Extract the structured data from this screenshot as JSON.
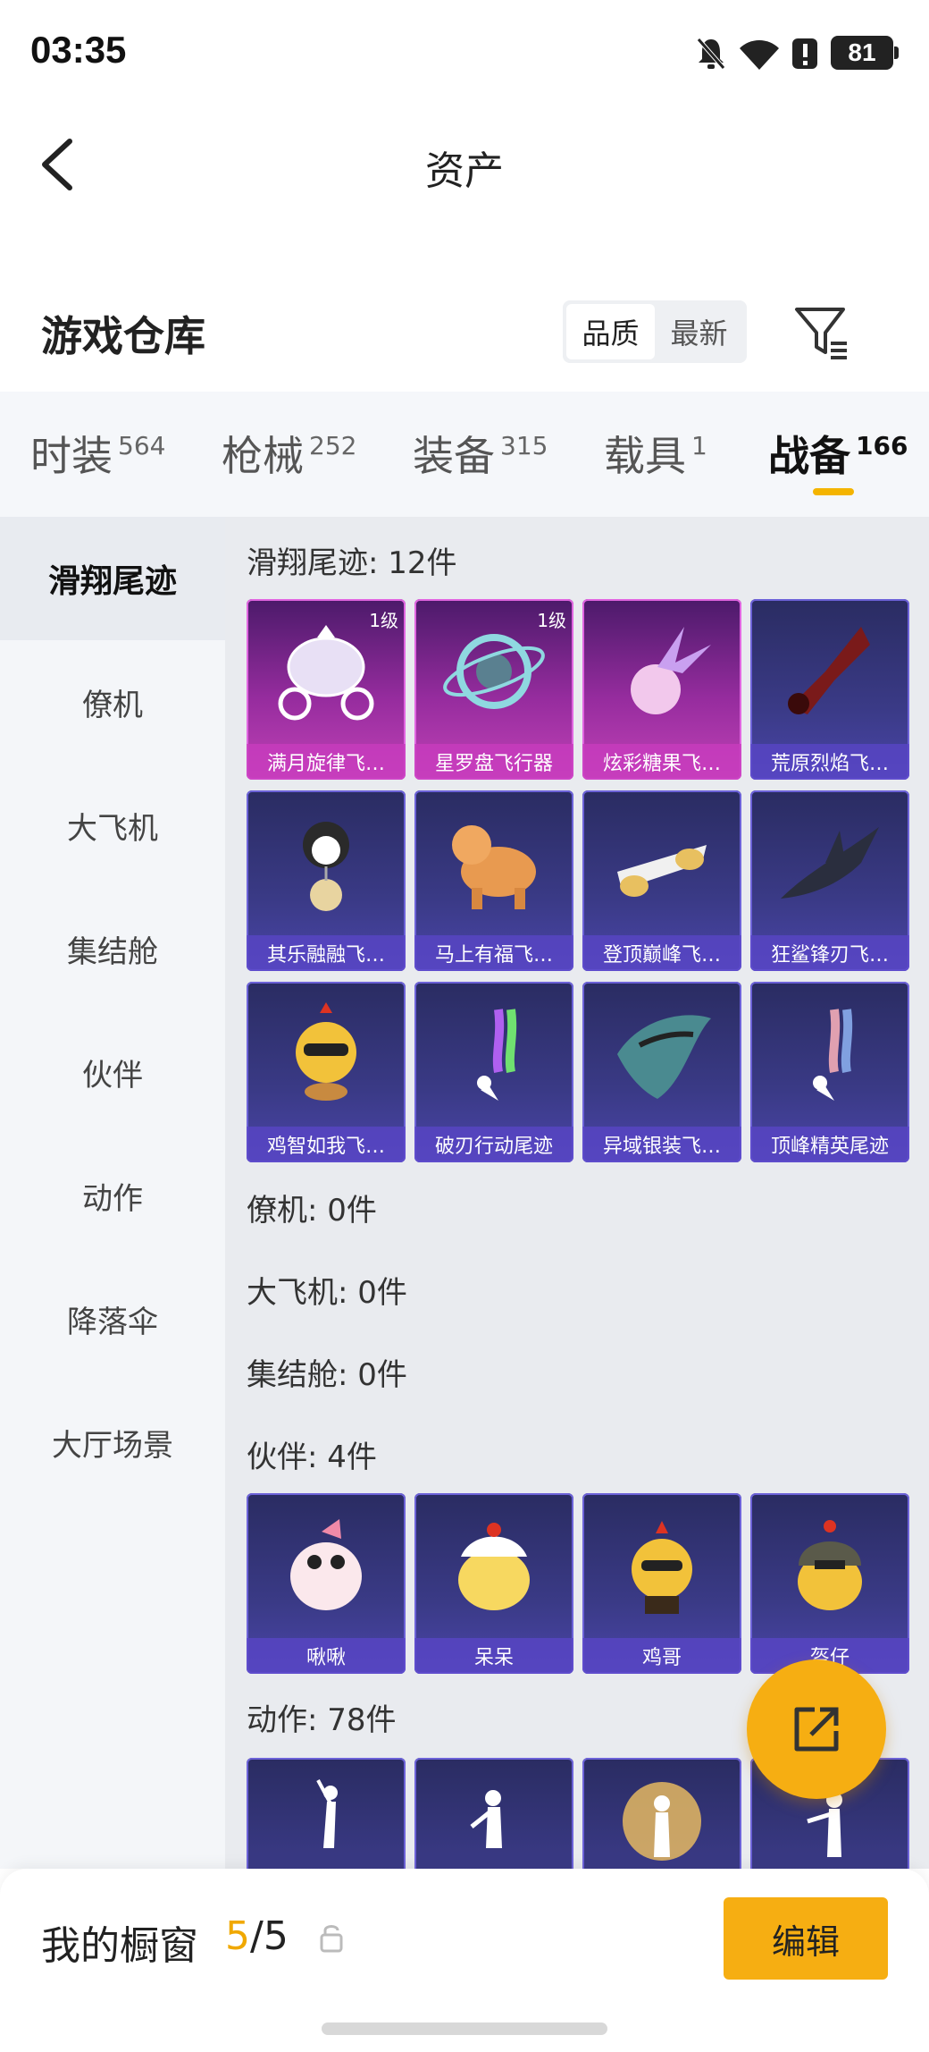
{
  "status_bar": {
    "time": "03:35",
    "battery": "81"
  },
  "header": {
    "title": "资产"
  },
  "warehouse": {
    "title": "游戏仓库",
    "sort_options": [
      "品质",
      "最新"
    ]
  },
  "tabs": [
    {
      "label": "时装",
      "count": "564"
    },
    {
      "label": "枪械",
      "count": "252"
    },
    {
      "label": "装备",
      "count": "315"
    },
    {
      "label": "载具",
      "count": "1"
    },
    {
      "label": "战备",
      "count": "166"
    }
  ],
  "sidebar": [
    "滑翔尾迹",
    "僚机",
    "大飞机",
    "集结舱",
    "伙伴",
    "动作",
    "降落伞",
    "大厅场景"
  ],
  "sections": {
    "glide": {
      "heading": "滑翔尾迹: 12件",
      "items": [
        {
          "name": "满月旋律飞…",
          "level": "1级"
        },
        {
          "name": "星罗盘飞行器",
          "level": "1级"
        },
        {
          "name": "炫彩糖果飞…"
        },
        {
          "name": "荒原烈焰飞…"
        },
        {
          "name": "其乐融融飞…"
        },
        {
          "name": "马上有福飞…"
        },
        {
          "name": "登顶巅峰飞…"
        },
        {
          "name": "狂鲨锋刃飞…"
        },
        {
          "name": "鸡智如我飞…"
        },
        {
          "name": "破刃行动尾迹"
        },
        {
          "name": "异域银装飞…"
        },
        {
          "name": "顶峰精英尾迹"
        }
      ]
    },
    "wingman": {
      "heading": "僚机: 0件"
    },
    "big_plane": {
      "heading": "大飞机: 0件"
    },
    "assembly": {
      "heading": "集结舱: 0件"
    },
    "partner": {
      "heading": "伙伴: 4件",
      "items": [
        {
          "name": "啾啾"
        },
        {
          "name": "呆呆"
        },
        {
          "name": "鸡哥"
        },
        {
          "name": "盔仔"
        }
      ]
    },
    "emote": {
      "heading": "动作: 78件"
    }
  },
  "bottom": {
    "showcase_label": "我的橱窗",
    "count_current": "5",
    "count_total": "/5",
    "edit_label": "编辑"
  }
}
